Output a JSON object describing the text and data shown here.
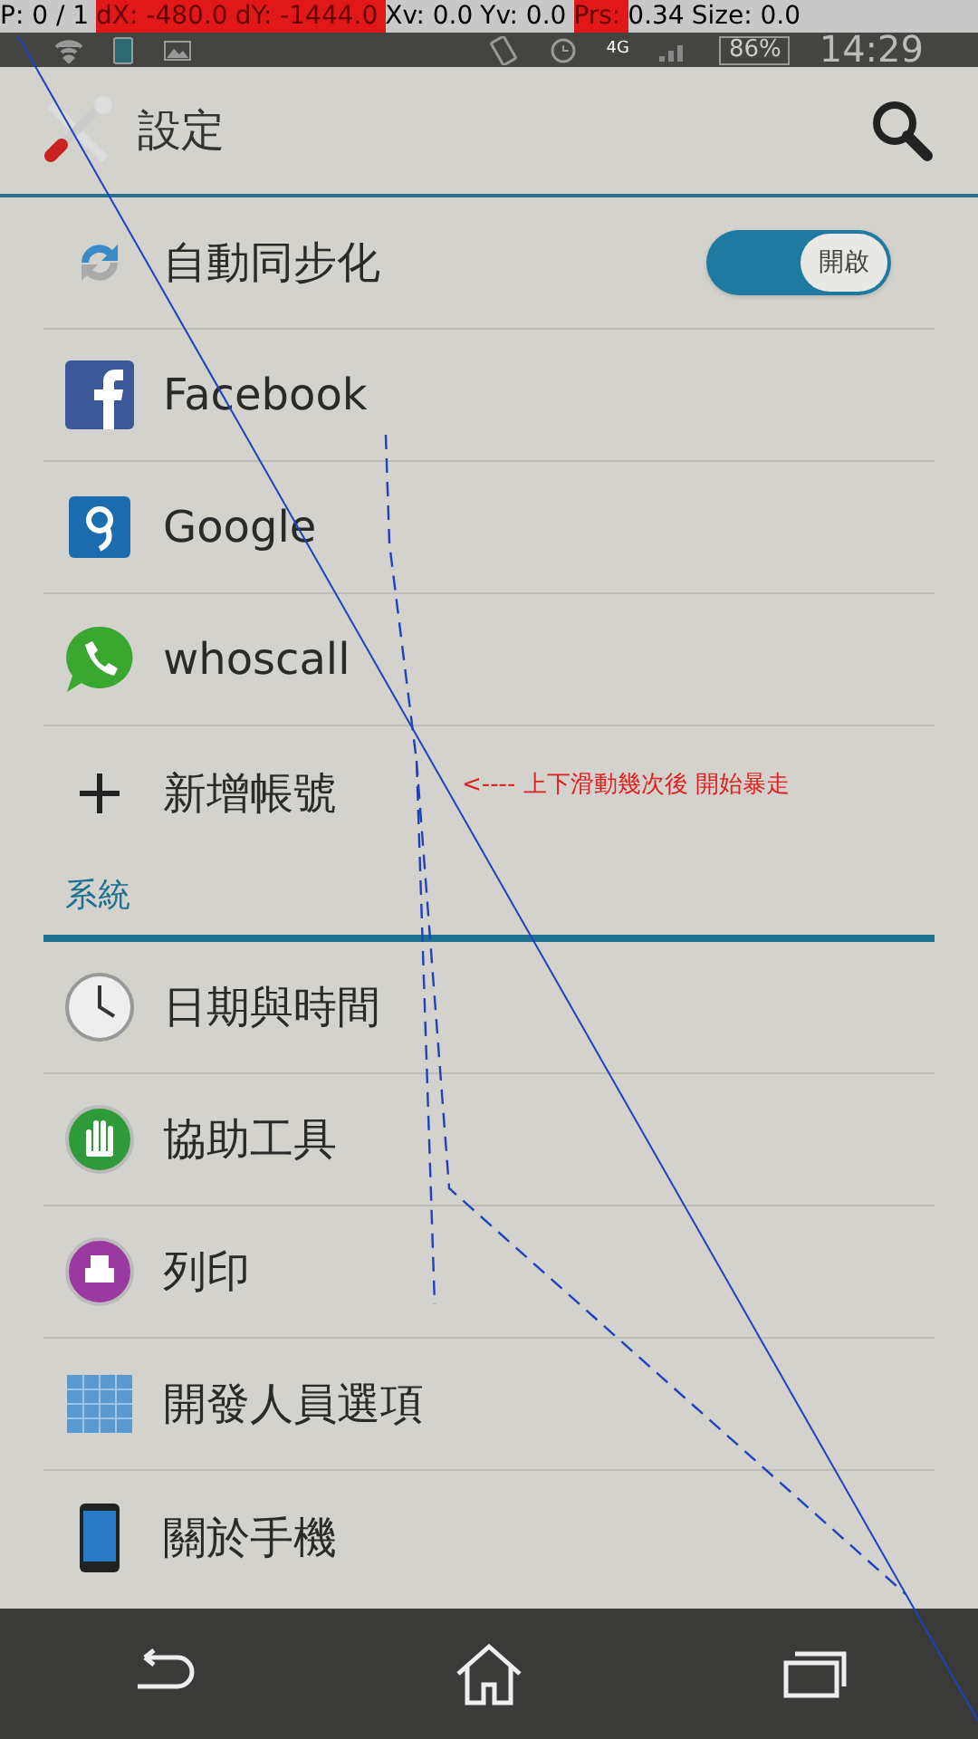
{
  "pointer_info": [
    {
      "text": "P: 0 / 1",
      "highlighted": false
    },
    {
      "text": "dX: -480.0",
      "highlighted": true
    },
    {
      "text": "dY: -1444.0",
      "highlighted": true
    },
    {
      "text": "Xv: 0.0",
      "highlighted": false
    },
    {
      "text": "Yv: 0.0",
      "highlighted": false
    },
    {
      "text": "Prs:",
      "highlighted": true
    },
    {
      "text": "0.34",
      "highlighted": false
    },
    {
      "text": "Size: 0.0",
      "highlighted": false
    }
  ],
  "status_bar": {
    "network": "4G",
    "battery": "86%",
    "time": "14:29"
  },
  "header": {
    "title": "設定"
  },
  "accounts": [
    {
      "kind": "sync",
      "label": "自動同步化",
      "toggle": {
        "label": "開啟",
        "on": true
      }
    },
    {
      "kind": "facebook",
      "label": "Facebook"
    },
    {
      "kind": "google",
      "label": "Google"
    },
    {
      "kind": "whoscall",
      "label": "whoscall"
    },
    {
      "kind": "add",
      "label": "新增帳號"
    }
  ],
  "annotation": "<---- 上下滑動幾次後 開始暴走",
  "section": "系統",
  "system": [
    {
      "kind": "clock",
      "label": "日期與時間"
    },
    {
      "kind": "hand",
      "label": "協助工具"
    },
    {
      "kind": "print",
      "label": "列印"
    },
    {
      "kind": "dev",
      "label": "開發人員選項"
    },
    {
      "kind": "phone",
      "label": "關於手機"
    }
  ]
}
